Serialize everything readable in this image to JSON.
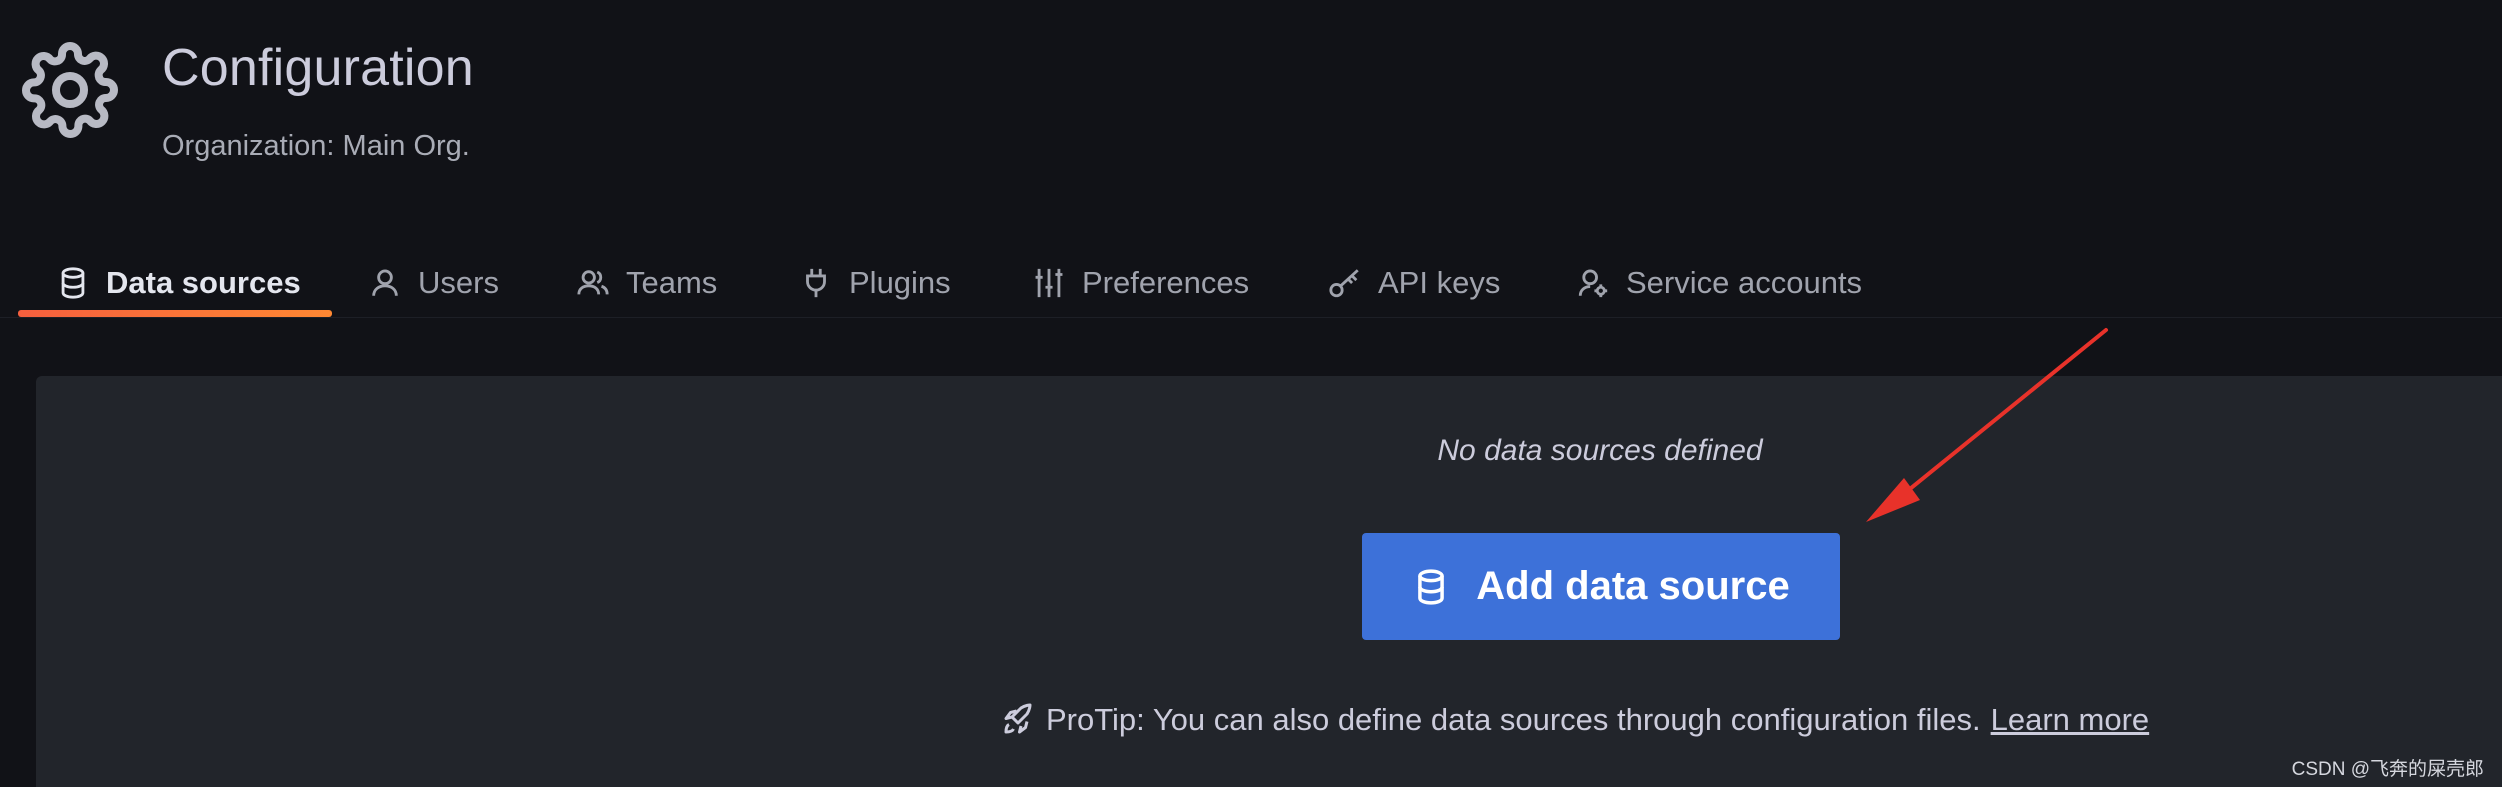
{
  "header": {
    "title": "Configuration",
    "subtitle": "Organization: Main Org."
  },
  "tabs": [
    {
      "label": "Data sources",
      "icon": "database-icon",
      "active": true
    },
    {
      "label": "Users",
      "icon": "user-icon",
      "active": false
    },
    {
      "label": "Teams",
      "icon": "users-icon",
      "active": false
    },
    {
      "label": "Plugins",
      "icon": "plug-icon",
      "active": false
    },
    {
      "label": "Preferences",
      "icon": "sliders-icon",
      "active": false
    },
    {
      "label": "API keys",
      "icon": "key-icon",
      "active": false
    },
    {
      "label": "Service accounts",
      "icon": "user-cog-icon",
      "active": false
    }
  ],
  "empty_state": {
    "message": "No data sources defined",
    "button_label": "Add data source",
    "button_icon": "database-icon",
    "protip_text": "ProTip: You can also define data sources through configuration files.",
    "protip_link": "Learn more",
    "protip_icon": "rocket-icon"
  },
  "watermark": "CSDN @飞奔的屎壳郎",
  "colors": {
    "background": "#111217",
    "panel": "#22252b",
    "primary": "#3d71d9",
    "tab_underline": "#f55f3e",
    "annotation_arrow": "#e8322a"
  }
}
